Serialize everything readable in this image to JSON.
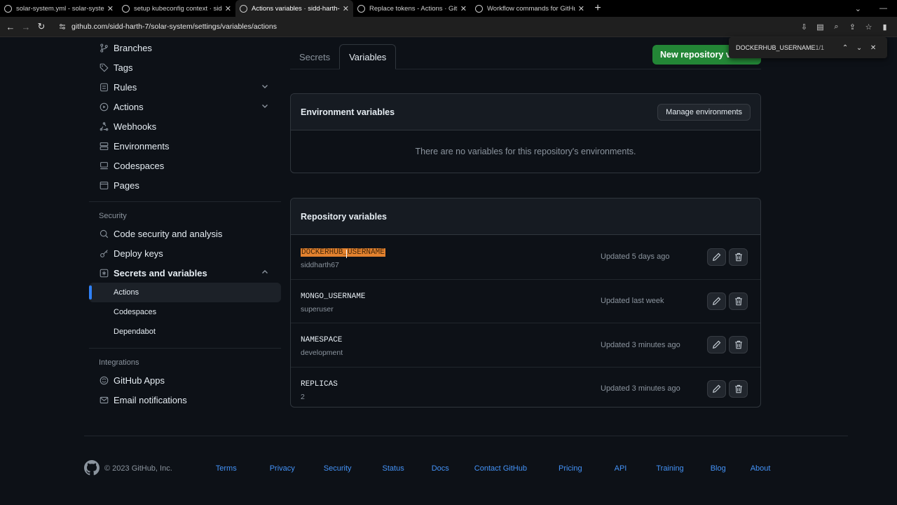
{
  "browser": {
    "tabs": [
      {
        "title": "solar-system.yml - solar-system",
        "active": false
      },
      {
        "title": "setup kubeconfig context · sidd-",
        "active": false
      },
      {
        "title": "Actions variables · sidd-harth-7/",
        "active": true
      },
      {
        "title": "Replace tokens - Actions · GitHub",
        "active": false
      },
      {
        "title": "Workflow commands for GitHub",
        "active": false
      }
    ],
    "url": "github.com/sidd-harth-7/solar-system/settings/variables/actions"
  },
  "findbar": {
    "query": "DOCKERHUB_USERNAME",
    "count": "1/1"
  },
  "sidebar": {
    "items": [
      {
        "label": "Branches",
        "icon": "branch-icon"
      },
      {
        "label": "Tags",
        "icon": "tag-icon"
      },
      {
        "label": "Rules",
        "icon": "rules-icon",
        "chevron": "down"
      },
      {
        "label": "Actions",
        "icon": "play-icon",
        "chevron": "down"
      },
      {
        "label": "Webhooks",
        "icon": "webhook-icon"
      },
      {
        "label": "Environments",
        "icon": "server-icon"
      },
      {
        "label": "Codespaces",
        "icon": "codespaces-icon"
      },
      {
        "label": "Pages",
        "icon": "browser-icon"
      }
    ],
    "security_heading": "Security",
    "security_items": [
      {
        "label": "Code security and analysis",
        "icon": "codescan-icon"
      },
      {
        "label": "Deploy keys",
        "icon": "key-icon"
      },
      {
        "label": "Secrets and variables",
        "icon": "asterisk-icon",
        "chevron": "up"
      }
    ],
    "sub_items": [
      {
        "label": "Actions",
        "active": true
      },
      {
        "label": "Codespaces",
        "active": false
      },
      {
        "label": "Dependabot",
        "active": false
      }
    ],
    "integrations_heading": "Integrations",
    "integration_items": [
      {
        "label": "GitHub Apps",
        "icon": "apps-icon"
      },
      {
        "label": "Email notifications",
        "icon": "mail-icon"
      }
    ]
  },
  "main": {
    "tabs": [
      {
        "label": "Secrets",
        "active": false
      },
      {
        "label": "Variables",
        "active": true
      }
    ],
    "new_variable_button": "New repository variable",
    "environment": {
      "title": "Environment variables",
      "manage_button": "Manage environments",
      "empty_text": "There are no variables for this repository's environments."
    },
    "repository": {
      "title": "Repository variables",
      "variables": [
        {
          "name": "DOCKERHUB_USERNAME",
          "value": "siddharth67",
          "updated": "Updated 5 days ago",
          "highlighted": true
        },
        {
          "name": "MONGO_USERNAME",
          "value": "superuser",
          "updated": "Updated last week",
          "highlighted": false
        },
        {
          "name": "NAMESPACE",
          "value": "development",
          "updated": "Updated 3 minutes ago",
          "highlighted": false
        },
        {
          "name": "REPLICAS",
          "value": "2",
          "updated": "Updated 3 minutes ago",
          "highlighted": false
        }
      ]
    }
  },
  "footer": {
    "copyright": "© 2023 GitHub, Inc.",
    "links": [
      "Terms",
      "Privacy",
      "Security",
      "Status",
      "Docs",
      "Contact GitHub",
      "Pricing",
      "API",
      "Training",
      "Blog",
      "About"
    ]
  },
  "colors": {
    "background": "#0d1117",
    "accent_green": "#238636",
    "link_blue": "#4493f8",
    "find_highlight": "#e3822f"
  }
}
